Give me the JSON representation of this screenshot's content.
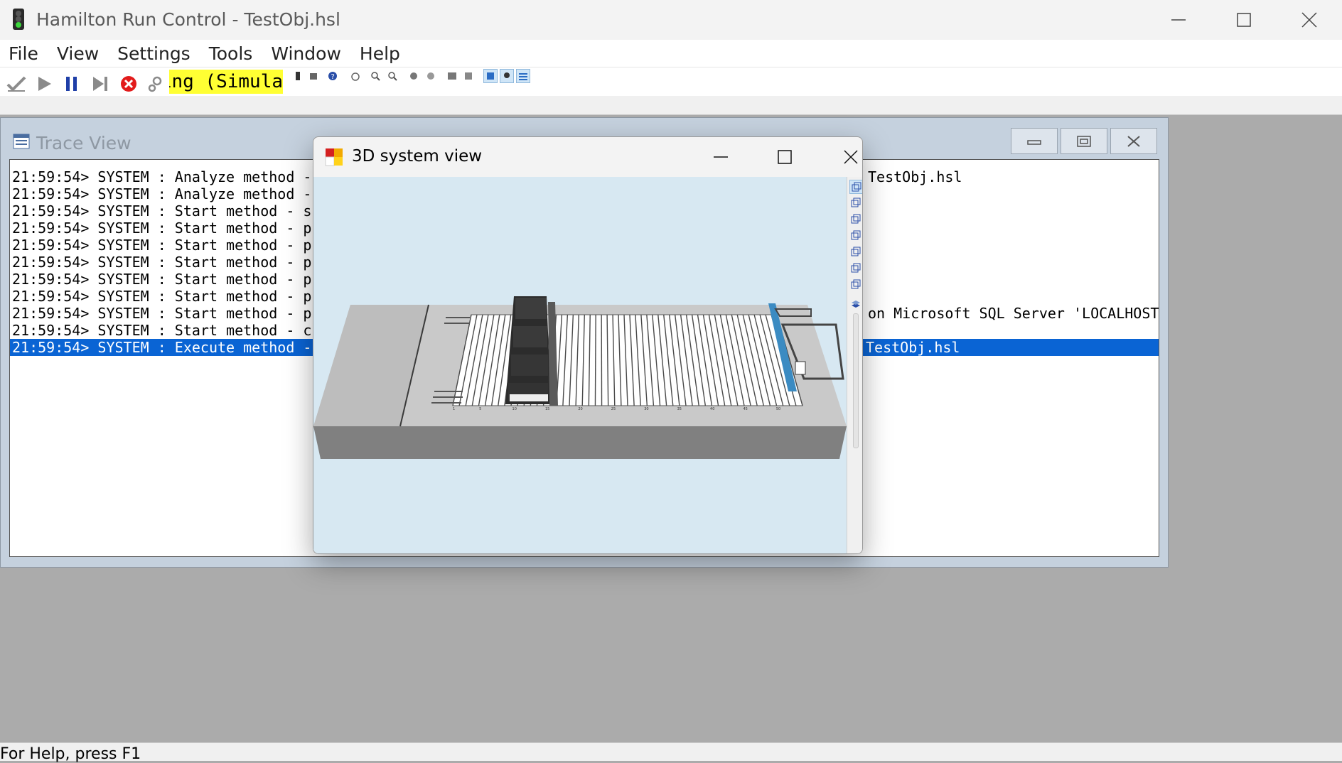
{
  "app": {
    "title": "Hamilton Run Control - TestObj.hsl"
  },
  "menu": [
    "File",
    "View",
    "Settings",
    "Tools",
    "Window",
    "Help"
  ],
  "toolbar": {
    "status_text": "ing (Simula",
    "status_color": "#ffff33",
    "buttons": [
      "check-icon",
      "play-icon",
      "pause-icon",
      "step-forward-icon",
      "abort-icon",
      "settings-gear-icon"
    ]
  },
  "trace_window": {
    "title": "Trace View",
    "lines": [
      {
        "time": "21:59:54>",
        "text": "SYSTEM : Analyze method -",
        "tail": "TestObj.hsl",
        "selected": false
      },
      {
        "time": "21:59:54>",
        "text": "SYSTEM : Analyze method -",
        "tail": "",
        "selected": false
      },
      {
        "time": "21:59:54>",
        "text": "SYSTEM : Start method - s",
        "tail": "",
        "selected": false
      },
      {
        "time": "21:59:54>",
        "text": "SYSTEM : Start method - p",
        "tail": "",
        "selected": false
      },
      {
        "time": "21:59:54>",
        "text": "SYSTEM : Start method - p",
        "tail": "",
        "selected": false
      },
      {
        "time": "21:59:54>",
        "text": "SYSTEM : Start method - p",
        "tail": "",
        "selected": false
      },
      {
        "time": "21:59:54>",
        "text": "SYSTEM : Start method - p",
        "tail": "",
        "selected": false
      },
      {
        "time": "21:59:54>",
        "text": "SYSTEM : Start method - p",
        "tail": "",
        "selected": false
      },
      {
        "time": "21:59:54>",
        "text": "SYSTEM : Start method - p",
        "tail": "on Microsoft SQL Server 'LOCALHOST'",
        "selected": false
      },
      {
        "time": "21:59:54>",
        "text": "SYSTEM : Start method - c",
        "tail": "",
        "selected": false
      },
      {
        "time": "21:59:54>",
        "text": "SYSTEM : Execute method -",
        "tail": "TestObj.hsl",
        "selected": true
      }
    ],
    "selection_color": "#0a64d4"
  },
  "dialog": {
    "title": "3D system view",
    "viewport_bg": "#d7e8f2",
    "deck_scale_labels": [
      "1",
      "5",
      "10",
      "15",
      "20",
      "25",
      "30",
      "35",
      "40",
      "45",
      "50"
    ]
  },
  "statusbar": {
    "text": "For Help, press F1"
  }
}
